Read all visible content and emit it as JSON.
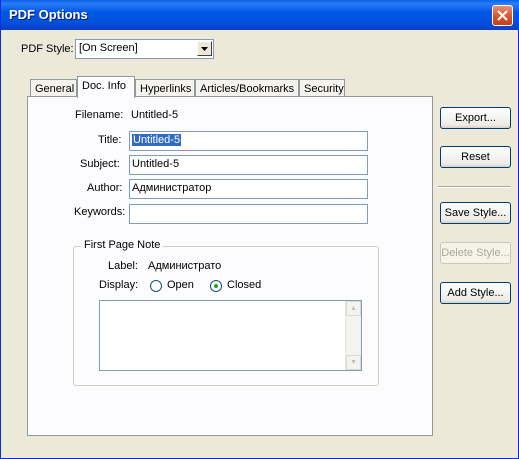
{
  "window": {
    "title": "PDF Options"
  },
  "pdf_style": {
    "label": "PDF Style:",
    "value": "[On Screen]"
  },
  "tabs": [
    {
      "label": "General"
    },
    {
      "label": "Doc. Info"
    },
    {
      "label": "Hyperlinks"
    },
    {
      "label": "Articles/Bookmarks"
    },
    {
      "label": "Security"
    }
  ],
  "doc_info": {
    "filename_label": "Filename:",
    "filename_value": "Untitled-5",
    "title_label": "Title:",
    "title_value": "Untitled-5",
    "subject_label": "Subject:",
    "subject_value": "Untitled-5",
    "author_label": "Author:",
    "author_value": "Администратор",
    "keywords_label": "Keywords:",
    "keywords_value": ""
  },
  "first_page_note": {
    "group_title": "First Page Note",
    "label_label": "Label:",
    "label_value": "Администрато",
    "display_label": "Display:",
    "open_label": "Open",
    "closed_label": "Closed",
    "selected": "Closed",
    "note_text": ""
  },
  "buttons": {
    "export": "Export...",
    "reset": "Reset",
    "save_style": "Save Style...",
    "delete_style": "Delete Style...",
    "add_style": "Add Style..."
  },
  "colors": {
    "titlebar": "#0058e6",
    "selection": "#316ac5",
    "face": "#ece9d8"
  }
}
